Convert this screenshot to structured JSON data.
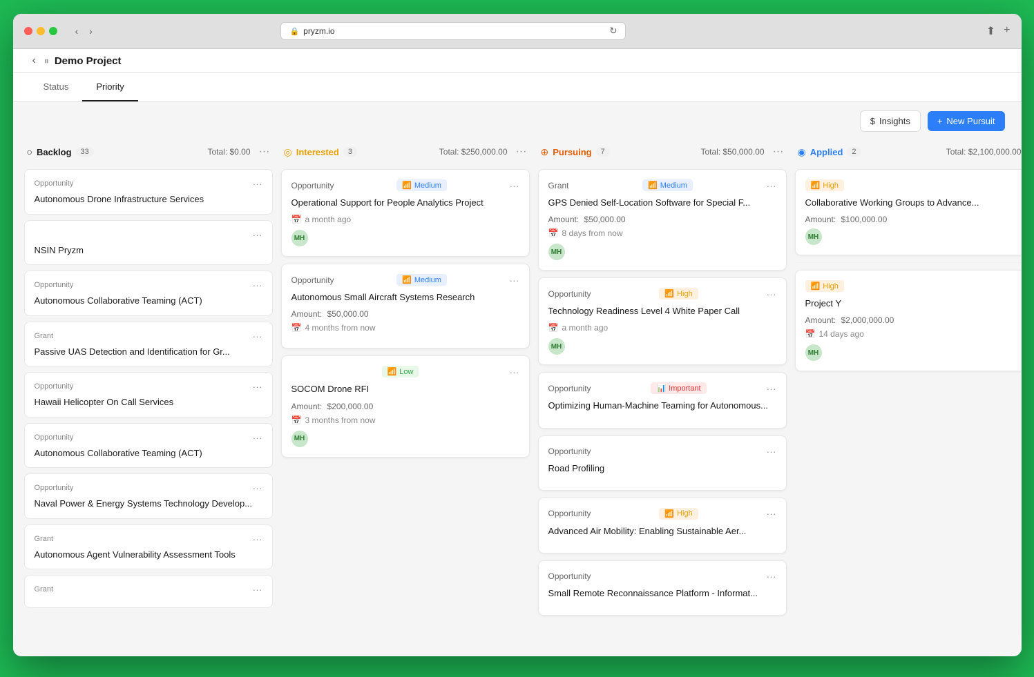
{
  "browser": {
    "url": "pryzm.io",
    "back_label": "‹",
    "forward_label": "›"
  },
  "app": {
    "back_btn": "‹",
    "menu_icon": "⏸",
    "project_title": "Demo Project",
    "tabs": [
      {
        "id": "status",
        "label": "Status",
        "active": false
      },
      {
        "id": "priority",
        "label": "Priority",
        "active": true
      }
    ],
    "toolbar": {
      "insights_label": "Insights",
      "new_pursuit_label": "New Pursuit",
      "dollar_icon": "$",
      "plus_icon": "+"
    }
  },
  "columns": [
    {
      "id": "backlog",
      "title": "Backlog",
      "title_class": "backlog",
      "status_icon": "○",
      "count": "33",
      "total": "Total: $0.00",
      "cards": [
        {
          "type": "Opportunity",
          "title": "Autonomous Drone Infrastructure Services"
        },
        {
          "type": "",
          "title": "NSIN Pryzm"
        },
        {
          "type": "Opportunity",
          "title": "Autonomous Collaborative Teaming (ACT)"
        },
        {
          "type": "Grant",
          "title": "Passive UAS Detection and Identification for Gr..."
        },
        {
          "type": "Opportunity",
          "title": "Hawaii Helicopter On Call Services"
        },
        {
          "type": "Opportunity",
          "title": "Autonomous Collaborative Teaming (ACT)"
        },
        {
          "type": "Opportunity",
          "title": "Naval Power & Energy Systems Technology Develop..."
        },
        {
          "type": "Grant",
          "title": "Autonomous Agent Vulnerability Assessment Tools"
        },
        {
          "type": "Grant",
          "title": ""
        }
      ]
    },
    {
      "id": "interested",
      "title": "Interested",
      "title_class": "interested",
      "status_icon": "◎",
      "count": "3",
      "total": "Total: $250,000.00",
      "cards": [
        {
          "type": "Opportunity",
          "badge": "Medium",
          "badge_class": "badge-medium",
          "badge_icon": "📊",
          "title": "Operational Support for People Analytics Project",
          "amount": null,
          "date": "a month ago",
          "avatar": "MH",
          "has_amount": false
        },
        {
          "type": "Opportunity",
          "badge": "Medium",
          "badge_class": "badge-medium",
          "badge_icon": "📊",
          "title": "Autonomous Small Aircraft Systems Research",
          "amount": "$50,000.00",
          "date": "4 months from now",
          "avatar": null,
          "has_amount": true
        },
        {
          "type": "",
          "badge": "Low",
          "badge_class": "badge-low",
          "badge_icon": "📊",
          "title": "SOCOM Drone RFI",
          "amount": "$200,000.00",
          "date": "3 months from now",
          "avatar": "MH",
          "has_amount": true
        }
      ]
    },
    {
      "id": "pursuing",
      "title": "Pursuing",
      "title_class": "pursuing",
      "status_icon": "⊕",
      "count": "7",
      "total": "Total: $50,000.00",
      "cards": [
        {
          "type": "Grant",
          "badge": "Medium",
          "badge_class": "badge-medium",
          "badge_icon": "📊",
          "title": "GPS Denied Self-Location Software for Special F...",
          "amount": "$50,000.00",
          "date": "8 days from now",
          "avatar": "MH",
          "has_amount": true
        },
        {
          "type": "Opportunity",
          "badge": "High",
          "badge_class": "badge-high",
          "badge_icon": "📊",
          "title": "Technology Readiness Level 4 White Paper Call",
          "amount": null,
          "date": "a month ago",
          "avatar": "MH",
          "has_amount": false
        },
        {
          "type": "Opportunity",
          "badge": "Important",
          "badge_class": "badge-important",
          "badge_icon": "📊",
          "title": "Optimizing Human-Machine Teaming for Autonomous...",
          "amount": null,
          "date": null,
          "avatar": null,
          "has_amount": false
        },
        {
          "type": "Opportunity",
          "badge": null,
          "badge_class": "",
          "badge_icon": "",
          "title": "Road Profiling",
          "amount": null,
          "date": null,
          "avatar": null,
          "has_amount": false
        },
        {
          "type": "Opportunity",
          "badge": "High",
          "badge_class": "badge-high",
          "badge_icon": "📊",
          "title": "Advanced Air Mobility: Enabling Sustainable Aer...",
          "amount": null,
          "date": null,
          "avatar": null,
          "has_amount": false
        },
        {
          "type": "Opportunity",
          "badge": null,
          "badge_class": "",
          "badge_icon": "",
          "title": "Small Remote Reconnaissance Platform - Informat...",
          "amount": null,
          "date": null,
          "avatar": null,
          "has_amount": false
        }
      ]
    },
    {
      "id": "applied",
      "title": "Applied",
      "title_class": "applied",
      "status_icon": "◉",
      "count": "2",
      "total": "Total: $2,100,000.00",
      "cards": [
        {
          "type": "",
          "badge": "High",
          "badge_class": "badge-high",
          "badge_icon": "📊",
          "title": "Collaborative Working Groups to Advance...",
          "amount": "$100,000.00",
          "date": null,
          "avatar": "MH",
          "has_amount": true
        },
        {
          "type": "",
          "badge": "High",
          "badge_class": "badge-high",
          "badge_icon": "📊",
          "title": "Project Y",
          "amount": "$2,000,000.00",
          "date": "14 days ago",
          "avatar": "MH",
          "has_amount": true
        }
      ]
    }
  ],
  "labels": {
    "amount_label": "Amount:",
    "calendar_icon": "📅"
  }
}
